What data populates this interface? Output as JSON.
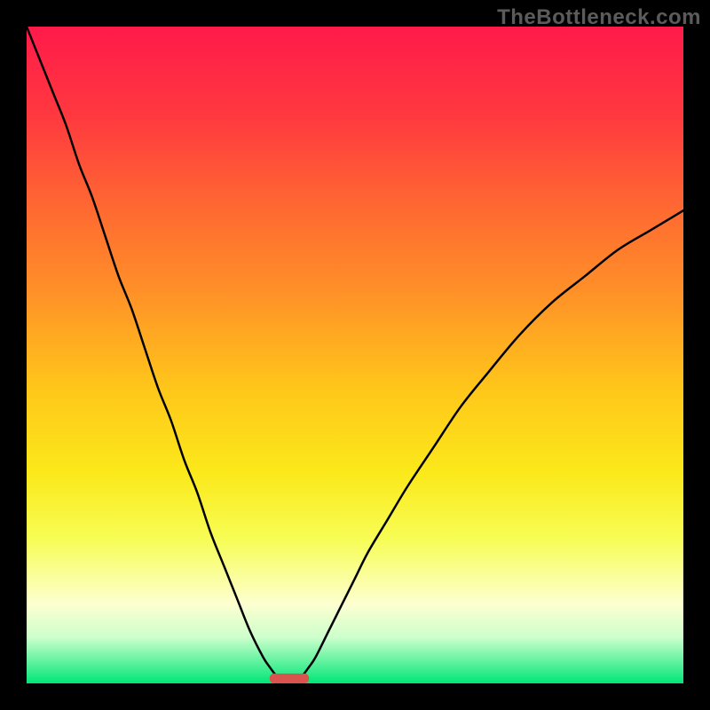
{
  "watermark_text": "TheBottleneck.com",
  "chart_data": {
    "type": "line",
    "title": "",
    "xlabel": "",
    "ylabel": "",
    "xlim": [
      0,
      100
    ],
    "ylim": [
      0,
      100
    ],
    "grid": false,
    "curve": {
      "name": "bottleneck-curve",
      "color": "#000000",
      "stroke_width": 2.5,
      "x": [
        0,
        2,
        4,
        6,
        8,
        10,
        12,
        14,
        16,
        18,
        20,
        22,
        24,
        26,
        28,
        30,
        32,
        34,
        36,
        37,
        38,
        39,
        40,
        41,
        42,
        43,
        44,
        46,
        48,
        50,
        52,
        55,
        58,
        62,
        66,
        70,
        75,
        80,
        85,
        90,
        95,
        100
      ],
      "y": [
        100,
        95,
        90,
        85,
        79,
        74,
        68,
        62,
        57,
        51,
        45,
        40,
        34,
        29,
        23,
        18,
        13,
        8,
        4,
        2.5,
        1.2,
        0.5,
        0,
        0.5,
        1.2,
        2.5,
        4,
        8,
        12,
        16,
        20,
        25,
        30,
        36,
        42,
        47,
        53,
        58,
        62,
        66,
        69,
        72
      ]
    },
    "marker": {
      "name": "optimal-range-marker",
      "shape": "rounded-rect",
      "x_center": 40,
      "y": 0,
      "width": 6,
      "height": 1.5,
      "fill": "#d9534f"
    },
    "background": {
      "type": "vertical-gradient",
      "stops": [
        {
          "pos": 0,
          "color": "#ff1a4a"
        },
        {
          "pos": 14,
          "color": "#ff3a3f"
        },
        {
          "pos": 28,
          "color": "#ff6a31"
        },
        {
          "pos": 40,
          "color": "#ff8f28"
        },
        {
          "pos": 55,
          "color": "#ffc61a"
        },
        {
          "pos": 68,
          "color": "#fbe91a"
        },
        {
          "pos": 78,
          "color": "#f7fd55"
        },
        {
          "pos": 88,
          "color": "#fdffd0"
        },
        {
          "pos": 93,
          "color": "#ccffcc"
        },
        {
          "pos": 100,
          "color": "#00e676"
        }
      ]
    }
  }
}
